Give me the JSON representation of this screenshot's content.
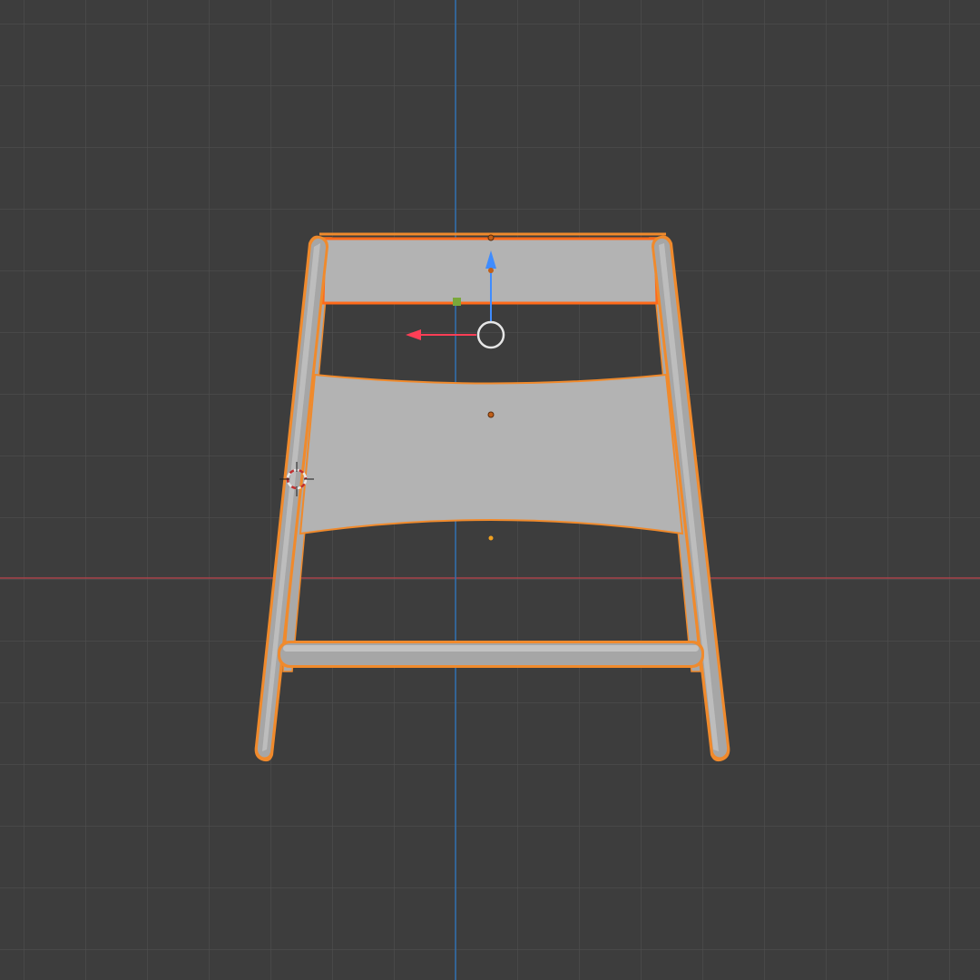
{
  "viewport": {
    "view": "orthographic-front",
    "background_color": "#3d3d3d",
    "grid_color": "#505050",
    "x_axis_color": "#a8434b",
    "z_axis_color": "#2f6fb0"
  },
  "object": {
    "kind": "chair-frame",
    "selected": true,
    "selection_outline_color": "#f08a2c",
    "active_outline_color": "#ff6a1a",
    "surface_color": "#b3b3b3"
  },
  "gizmo": {
    "x_arrow_color": "#ff3e56",
    "z_arrow_color": "#3f8cff",
    "ring_color": "#e6e6e6"
  },
  "icons": {
    "cursor": "3d-cursor-icon",
    "origin": "object-origin-icon"
  }
}
